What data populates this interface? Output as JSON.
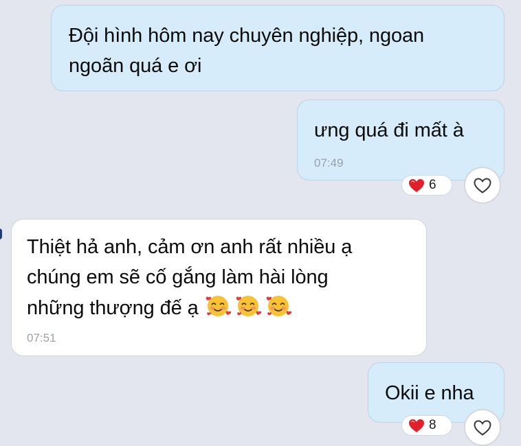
{
  "messages": [
    {
      "id": "m1",
      "direction": "sent",
      "text": "Đội hình hôm nay chuyên nghiệp, ngoan\nngoãn quá e ơi"
    },
    {
      "id": "m2",
      "direction": "sent",
      "text": "ưng quá đi mất à",
      "time": "07:49",
      "reaction": {
        "icon": "red-heart-emoji",
        "count": "6"
      },
      "react_button_icon": "heart-outline-icon"
    },
    {
      "id": "m3",
      "direction": "received",
      "text": "Thiệt hả anh, cảm ơn anh rất nhiều ạ\nchúng em sẽ cố gắng làm hài lòng\nnhững thượng đế ạ",
      "emojis": [
        "smiling-face-with-hearts",
        "smiling-face-with-hearts",
        "smiling-face-with-hearts"
      ],
      "time": "07:51"
    },
    {
      "id": "m4",
      "direction": "sent",
      "text": "Okii e nha",
      "reaction": {
        "icon": "red-heart-emoji",
        "count": "8"
      },
      "react_button_icon": "heart-outline-icon"
    }
  ],
  "colors": {
    "background": "#e3e6ee",
    "sent_bubble": "#d6ecfa",
    "received_bubble": "#ffffff",
    "heart": "#e0202a",
    "timestamp": "#9aa0a8"
  }
}
